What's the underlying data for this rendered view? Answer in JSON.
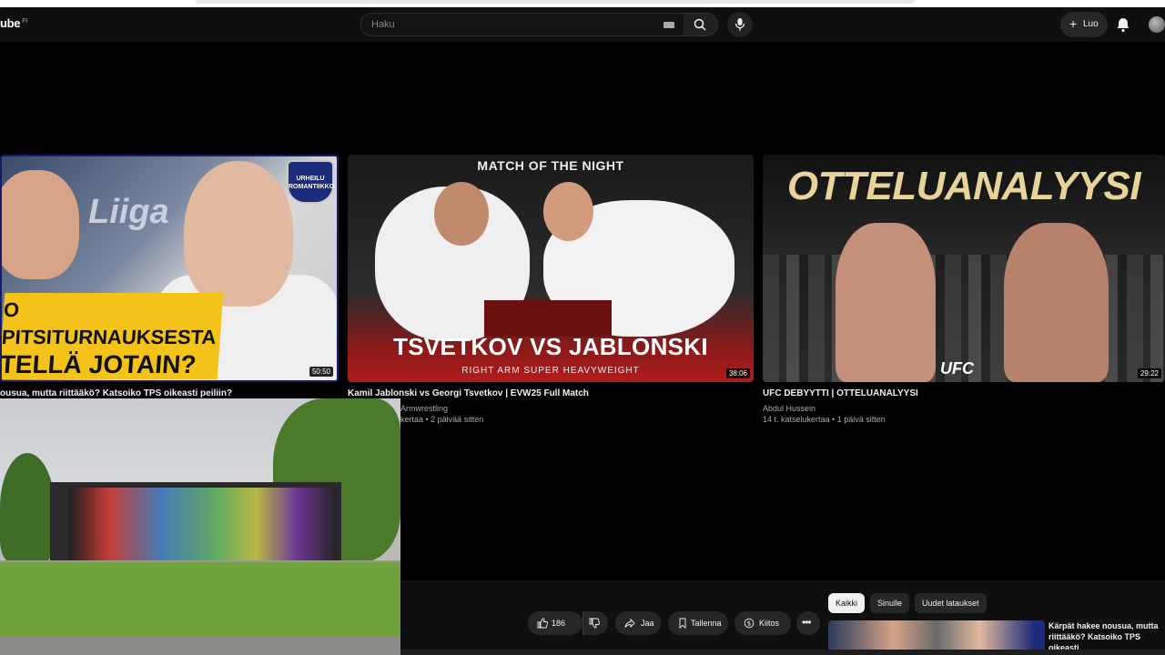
{
  "header": {
    "logo_text": "ube",
    "logo_region": "FI",
    "search_placeholder": "Haku",
    "create_label": "Luo"
  },
  "videos": [
    {
      "banner_line1": "O PITSITURNAUKSESTA",
      "banner_line2": "TELLÄ JOTAIN?",
      "overlay_text": "Liiga",
      "badge_text": "URHEILU ROMANTIIKKO",
      "duration": "50:50",
      "title": "ousua, mutta riittääkö? Katsoiko TPS oikeasti peiliin?"
    },
    {
      "top_text": "MATCH OF THE NIGHT",
      "overlay_title": "TSVETKOV VS JABLONSKI",
      "overlay_sub": "RIGHT ARM SUPER HEAVYWEIGHT",
      "duration": "38:06",
      "title": "Kamil Jablonski vs Georgi Tsvetkov | EVW25 Full Match",
      "channel": "Armwrestling",
      "meta": "kertaa • 2 päivää sitten"
    },
    {
      "overlay_title": "OTTELUANALYYSI",
      "overlay_logo": "UFC",
      "duration": "29:22",
      "title": "UFC DEBYYTTI | OTTELUANALYYSI",
      "channel": "Abdul Hussein",
      "meta": "14 t. katselukertaa • 1 päivä sitten"
    }
  ],
  "actions": {
    "like_count": "186",
    "share_label": "Jaa",
    "save_label": "Tallenna",
    "thanks_label": "Kiitos"
  },
  "chips": [
    "Kaikki",
    "Sinulle",
    "Uudet lataukset"
  ],
  "side_video": {
    "title": "Kärpät hakee nousua, mutta riittääkö? Katsoiko TPS oikeasti"
  }
}
